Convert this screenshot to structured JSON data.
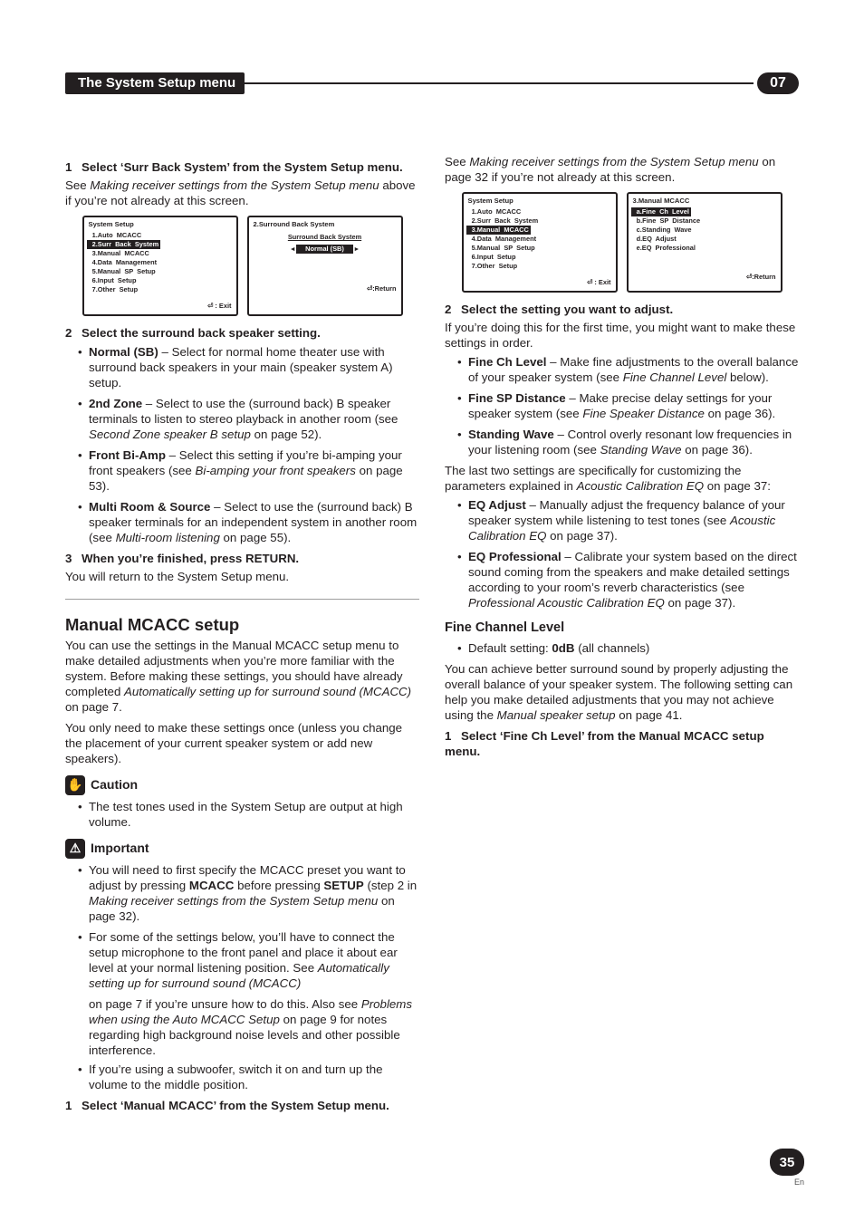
{
  "chapter": {
    "bar_title": "The System Setup menu",
    "number": "07"
  },
  "page": {
    "number": "35",
    "lang": "En"
  },
  "icons": {
    "caution_label": "Caution",
    "important_label": "Important"
  },
  "col1": {
    "step1": {
      "num": "1",
      "text": "Select ‘Surr Back System’ from the System Setup menu."
    },
    "p1a": "See ",
    "p1b": "Making receiver settings from the System Setup menu",
    "p1c": " above if you’re not already at this screen.",
    "osd_left": {
      "title": "System  Setup",
      "items": [
        "1.Auto  MCACC",
        "2.Surr  Back  System",
        "3.Manual  MCACC",
        "4.Data  Management",
        "5.Manual  SP  Setup",
        "6.Input  Setup",
        "7.Other  Setup"
      ],
      "highlight_index": 1,
      "foot": ": Exit"
    },
    "osd_right": {
      "title": "2.Surround  Back  System",
      "subhead": "Surround Back System",
      "pill": "Normal (SB)",
      "foot": ":Return"
    },
    "step2": {
      "num": "2",
      "text": "Select the surround back speaker setting."
    },
    "b1": {
      "title": "Normal (SB)",
      "rest": " – Select for normal home theater use with surround back speakers in your main (speaker system A) setup."
    },
    "b2": {
      "title": "2nd Zone",
      "rest_a": " – Select to use the (surround back) B speaker terminals to listen to stereo playback in another room (see ",
      "rest_i": "Second Zone speaker B setup",
      "rest_b": " on page 52)."
    },
    "b3": {
      "title": "Front Bi-Amp",
      "rest_a": " – Select this setting if you’re bi-amping your front speakers (see ",
      "rest_i": "Bi-amping your front speakers",
      "rest_b": " on page 53)."
    },
    "b4": {
      "title": "Multi Room & Source",
      "rest_a": " – Select to use the (surround back) B speaker terminals for an independent system in another room (see ",
      "rest_i": "Multi-room listening",
      "rest_b": " on page 55)."
    },
    "step3": {
      "num": "3",
      "text": "When you’re finished, press RETURN."
    },
    "p3": "You will return to the System Setup menu.",
    "h2": "Manual MCACC setup",
    "mp1a": "You can use the settings in the Manual MCACC setup menu to make detailed adjustments when you’re more familiar with the system. Before making these settings, you should have already completed ",
    "mp1i": "Automatically setting up for surround sound (MCACC)",
    "mp1b": " on page 7.",
    "mp2": "You only need to make these settings once (unless you change the placement of your current speaker system or add new speakers).",
    "caution_li": "The test tones used in the System Setup are output at high volume.",
    "imp_li1a": "You will need to first specify the MCACC preset you want to adjust by pressing ",
    "imp_li1b": "MCACC",
    "imp_li1c": " before pressing ",
    "imp_li1d": "SETUP",
    "imp_li1e": " (step 2 in ",
    "imp_li1i": "Making receiver settings from the System Setup menu",
    "imp_li1f": " on page 32).",
    "imp_li2a": "For some of the settings below, you’ll have to connect the setup microphone to the front panel and place it about ear level at your normal listening position. See ",
    "imp_li2i": "Automatically setting up for surround sound (MCACC)"
  },
  "col2": {
    "cont_a": "on page 7 if you’re unsure how to do this. Also see ",
    "cont_i": "Problems when using the Auto MCACC Setup",
    "cont_b": " on page 9 for notes regarding high background noise levels and other possible interference.",
    "sw": "If you’re using a subwoofer, switch it on and turn up the volume to the middle position.",
    "step1": {
      "num": "1",
      "text": "Select ‘Manual MCACC’ from the System Setup menu."
    },
    "p1a": "See ",
    "p1i": "Making receiver settings from the System Setup menu",
    "p1b": " on page 32 if you’re not already at this screen.",
    "osd_left": {
      "title": "System  Setup",
      "items": [
        "1.Auto  MCACC",
        "2.Surr  Back  System",
        "3.Manual  MCACC",
        "4.Data  Management",
        "5.Manual  SP  Setup",
        "6.Input  Setup",
        "7.Other  Setup"
      ],
      "highlight_index": 2,
      "foot": ": Exit"
    },
    "osd_right": {
      "title": "3.Manual  MCACC",
      "items": [
        "a.Fine  Ch  Level",
        "b.Fine  SP  Distance",
        "c.Standing  Wave",
        "d.EQ  Adjust",
        "e.EQ  Professional"
      ],
      "highlight_index": 0,
      "foot": ":Return"
    },
    "step2": {
      "num": "2",
      "text": "Select the setting you want to adjust."
    },
    "p2": "If you’re doing this for the first time, you might want to make these settings in order.",
    "b1": {
      "title": "Fine Ch Level",
      "rest_a": " – Make fine adjustments to the overall balance of your speaker system (see ",
      "rest_i": "Fine Channel Level",
      "rest_b": " below)."
    },
    "b2": {
      "title": "Fine SP Distance",
      "rest_a": " – Make precise delay settings for your speaker system (see ",
      "rest_i": "Fine Speaker Distance",
      "rest_b": " on page 36)."
    },
    "b3": {
      "title": "Standing Wave",
      "rest_a": " – Control overly resonant low frequencies in your listening room (see ",
      "rest_i": "Standing Wave",
      "rest_b": " on page 36)."
    },
    "p3a": "The last two settings are specifically for customizing the parameters explained in ",
    "p3i": "Acoustic Calibration EQ",
    "p3b": " on page 37:",
    "b4": {
      "title": "EQ Adjust",
      "rest_a": " – Manually adjust the frequency balance of your speaker system while listening to test tones (see ",
      "rest_i": "Acoustic Calibration EQ",
      "rest_b": " on page 37)."
    },
    "b5": {
      "title": "EQ Professional",
      "rest_a": " – Calibrate your system based on the direct sound coming from the speakers and make detailed settings according to your room’s reverb characteristics (see ",
      "rest_i": "Professional Acoustic Calibration EQ",
      "rest_b": " on page 37)."
    },
    "h3": "Fine Channel Level",
    "def_a": "Default setting: ",
    "def_b": "0dB",
    "def_c": " (all channels)",
    "fp1a": "You can achieve better surround sound by properly adjusting the overall balance of your speaker system. The following setting can help you make detailed adjustments that you may not achieve using the ",
    "fp1i": "Manual speaker setup",
    "fp1b": " on page 41.",
    "fstep1": {
      "num": "1",
      "text": "Select ‘Fine Ch Level’ from the Manual MCACC setup menu."
    }
  }
}
